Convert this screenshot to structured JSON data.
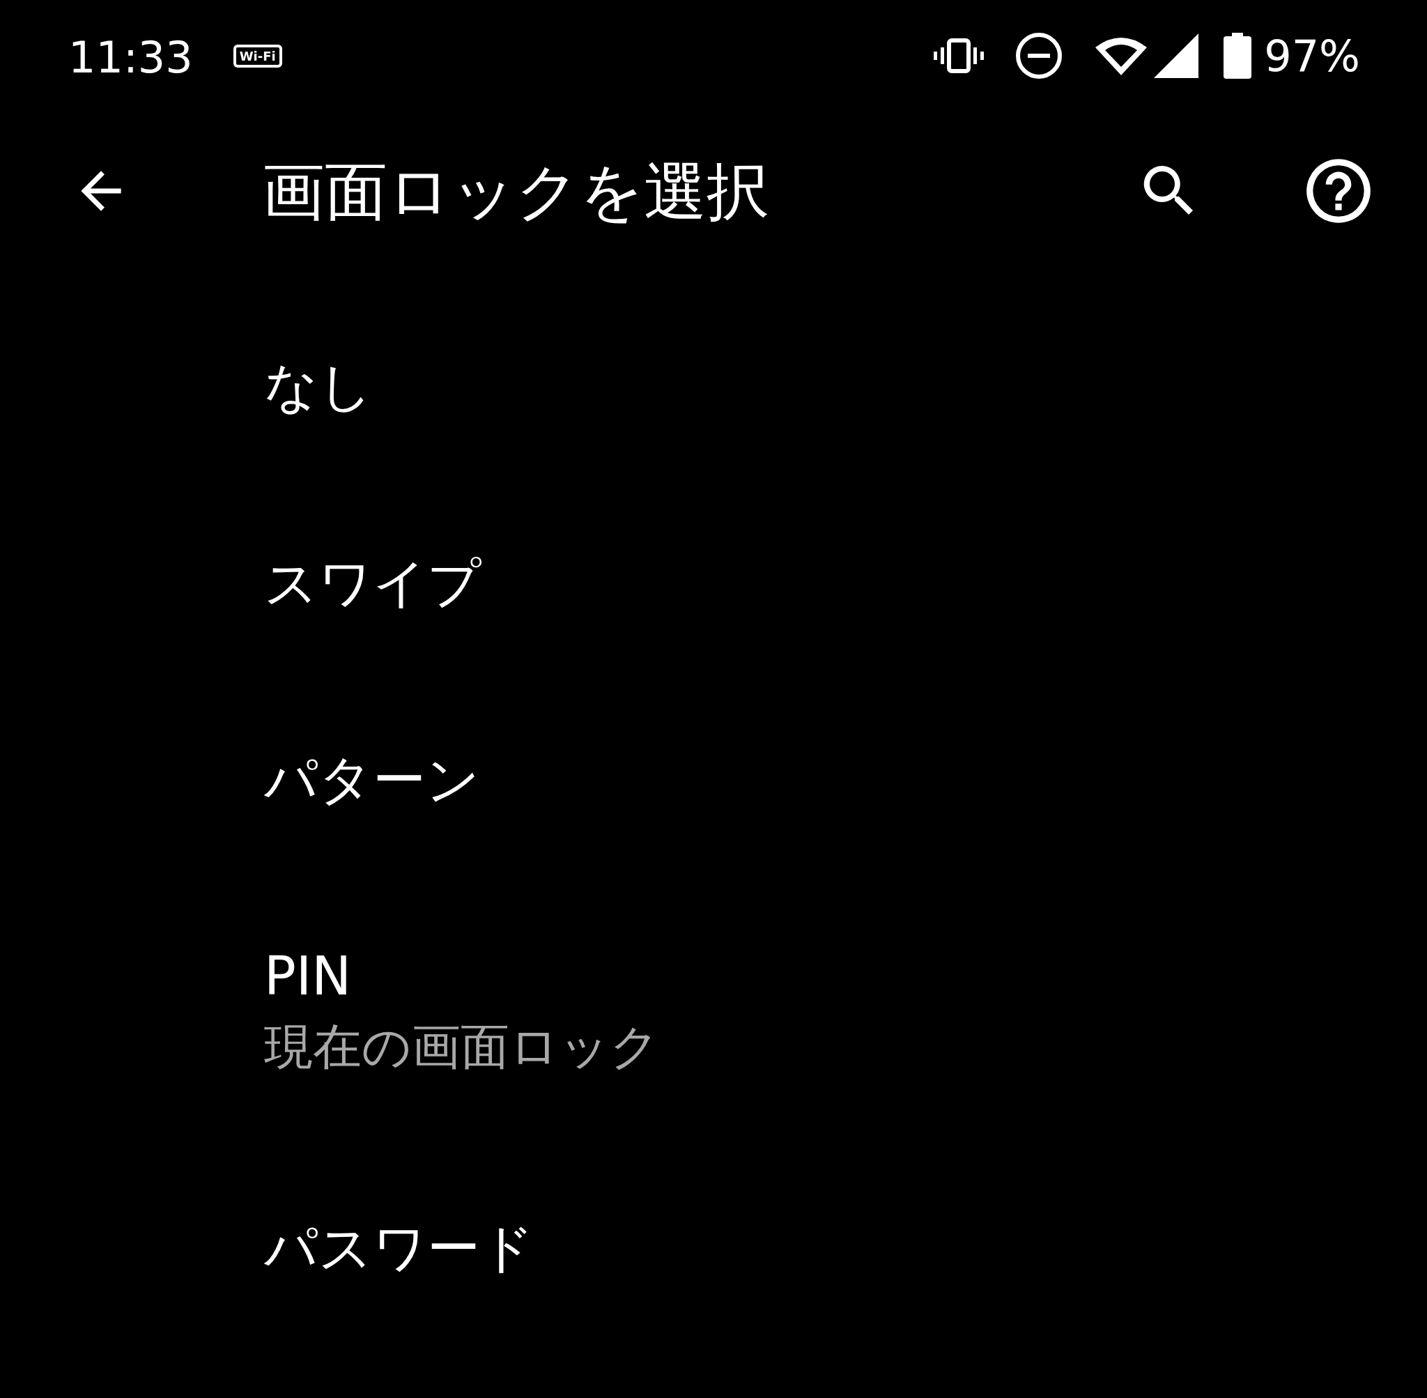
{
  "status_bar": {
    "time": "11:33",
    "wifi_badge": "Wi-Fi",
    "battery": "97%"
  },
  "toolbar": {
    "title": "画面ロックを選択"
  },
  "options": [
    {
      "title": "なし"
    },
    {
      "title": "スワイプ"
    },
    {
      "title": "パターン"
    },
    {
      "title": "PIN",
      "subtitle": "現在の画面ロック"
    },
    {
      "title": "パスワード"
    }
  ]
}
